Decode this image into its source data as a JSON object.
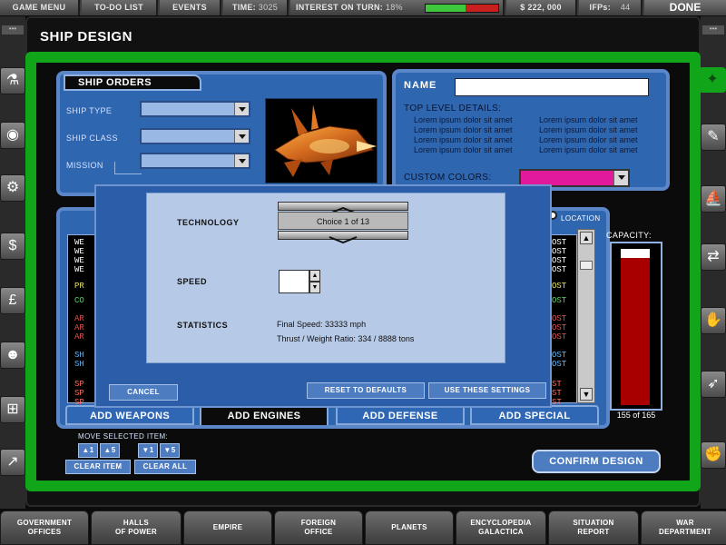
{
  "topbar": {
    "game_menu": "GAME MENU",
    "todo": "TO-DO LIST",
    "events": "EVENTS",
    "time_label": "TIME:",
    "time_value": "3025",
    "interest_label": "INTEREST ON TURN:",
    "interest_value": "18%",
    "interest_fill_fraction": 0.55,
    "money": "$ 222, 000",
    "ifps_label": "IFPs:",
    "ifps_value": "44",
    "done": "DONE"
  },
  "page_title": "SHIP DESIGN",
  "ship_orders": {
    "title": "SHIP ORDERS",
    "type_label": "SHIP TYPE",
    "class_label": "SHIP CLASS",
    "mission_label": "MISSION"
  },
  "name_label": "NAME",
  "top_level": {
    "title": "TOP LEVEL DETAILS:",
    "lines_left": [
      "Lorem ipsum dolor sit amet",
      "Lorem ipsum dolor sit amet",
      "Lorem ipsum dolor sit amet",
      "Lorem ipsum dolor sit amet"
    ],
    "lines_right": [
      "Lorem ipsum dolor sit amet",
      "Lorem ipsum dolor sit amet",
      "Lorem ipsum dolor sit amet",
      "Lorem ipsum dolor sit amet"
    ]
  },
  "custom_colors": {
    "label": "CUSTOM COLORS:",
    "swatch": "#e01a9a"
  },
  "location_label": "LOCATION",
  "capacity": {
    "label": "CAPACITY:",
    "readout": "155 of 165",
    "fill_fraction": 0.94
  },
  "dialog": {
    "technology_label": "TECHNOLOGY",
    "choice": "Choice 1 of 13",
    "speed_label": "SPEED",
    "statistics_label": "STATISTICS",
    "final_speed": "Final Speed:  33333 mph",
    "thrust_ratio": "Thrust / Weight Ratio:  334 / 8888 tons",
    "cancel": "CANCEL",
    "reset": "RESET TO DEFAULTS",
    "use": "USE THESE SETTINGS"
  },
  "list_left": [
    "WE",
    "WE",
    "WE",
    "WE",
    "PR",
    "CO",
    "AR",
    "AR",
    "AR",
    "SH",
    "SH",
    "SP",
    "SP",
    "SP"
  ],
  "list_right": [
    "OST",
    "OST",
    "OST",
    "OST",
    "OST",
    "OST",
    "OST",
    "OST",
    "OST",
    "OST",
    "OST",
    "ST",
    "ST",
    "ST"
  ],
  "tabs": {
    "weapons": "ADD WEAPONS",
    "engines": "ADD ENGINES",
    "defense": "ADD DEFENSE",
    "special": "ADD SPECIAL"
  },
  "move": {
    "label": "MOVE SELECTED ITEM:",
    "up1": "1",
    "up5": "5",
    "down1": "1",
    "down5": "5",
    "clear_item": "CLEAR ITEM",
    "clear_all": "CLEAR ALL"
  },
  "confirm": "CONFIRM DESIGN",
  "bottom_tabs": [
    {
      "l1": "GOVERNMENT",
      "l2": "OFFICES"
    },
    {
      "l1": "HALLS",
      "l2": "OF POWER"
    },
    {
      "l1": "EMPIRE",
      "l2": ""
    },
    {
      "l1": "FOREIGN",
      "l2": "OFFICE"
    },
    {
      "l1": "PLANETS",
      "l2": ""
    },
    {
      "l1": "ENCYCLOPEDIA",
      "l2": "GALACTICA"
    },
    {
      "l1": "SITUATION",
      "l2": "REPORT"
    },
    {
      "l1": "WAR",
      "l2": "DEPARTMENT"
    }
  ],
  "icons": {
    "left": [
      "flask-icon",
      "globe-icon",
      "gears-icon",
      "dollar-icon",
      "pound-icon",
      "people-icon",
      "flowchart-icon",
      "graph-icon"
    ],
    "right": [
      "wrench-icon",
      "ship-icon",
      "arrows-icon",
      "hand-icon",
      "rocket-icon",
      "fist-icon"
    ]
  },
  "colors": {
    "accent_green": "#11a51a",
    "panel_blue": "#2e66b0"
  }
}
